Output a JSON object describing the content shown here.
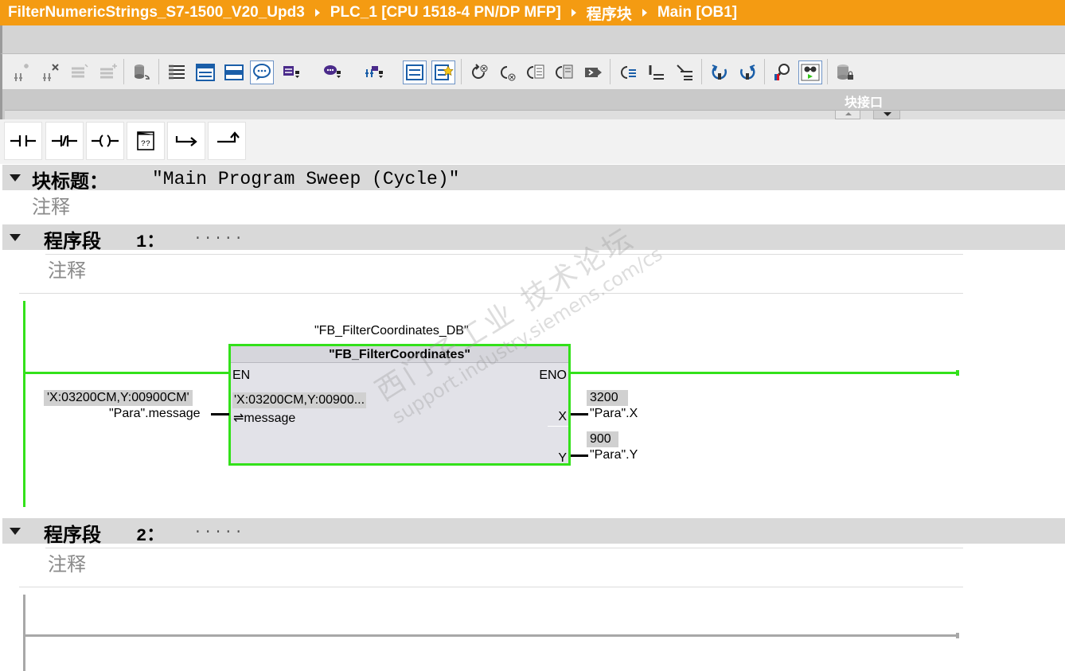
{
  "breadcrumb": {
    "project": "FilterNumericStrings_S7-1500_V20_Upd3",
    "device": "PLC_1 [CPU 1518-4 PN/DP MFP]",
    "folder": "程序块",
    "block": "Main [OB1]"
  },
  "toolbar_icons": [
    "insert-network-icon",
    "delete-network-icon",
    "insert-row-icon",
    "add-row-icon",
    "reset-startvalues-icon",
    "absolute-operands-icon",
    "show-favorites-icon",
    "show-status-bar-icon",
    "show-comments-icon",
    "show-symbol-info-icon",
    "show-tag-info-icon",
    "show-address-icon",
    "open-all-networks-icon",
    "show-list-icon",
    "go-to-error-icon",
    "go-to-previous-error-icon",
    "go-to-next-error-icon",
    "previous-error-icon",
    "next-error-icon",
    "update-calls-icon",
    "monitor-icon",
    "block-properties-icon",
    "monitoring-on-off-icon",
    "download-icon"
  ],
  "interface_label": "块接口",
  "lad_favorites": [
    "normally-open-contact-icon",
    "normally-closed-contact-icon",
    "output-coil-icon",
    "empty-box-icon",
    "open-branch-icon",
    "close-branch-icon"
  ],
  "block_title": {
    "label": "块标题：",
    "value": "\"Main Program Sweep (Cycle)\"",
    "comment": "注释"
  },
  "networks": [
    {
      "label": "程序段",
      "number": "1：",
      "title": ".....",
      "comment": "注释",
      "instance_db": "\"FB_FilterCoordinates_DB\"",
      "fb_name": "\"FB_FilterCoordinates\"",
      "en_label": "EN",
      "eno_label": "ENO",
      "input": {
        "pin": "⇌message",
        "pin_value": "'X:03200CM,Y:00900...",
        "operand_value": "'X:03200CM,Y:00900CM'",
        "operand": "\"Para\".message"
      },
      "outputs": [
        {
          "pin": "X",
          "value": "3200",
          "operand": "\"Para\".X"
        },
        {
          "pin": "Y",
          "value": "900",
          "operand": "\"Para\".Y"
        }
      ]
    },
    {
      "label": "程序段",
      "number": "2：",
      "title": ".....",
      "comment": "注释"
    }
  ],
  "watermark": {
    "line1": "西门子工业 技术论坛",
    "line2": "support.industry.siemens.com/cs"
  },
  "colors": {
    "title_bar": "#f49b12",
    "power_flow": "#33e11a",
    "header_gray": "#d9d9d9"
  }
}
